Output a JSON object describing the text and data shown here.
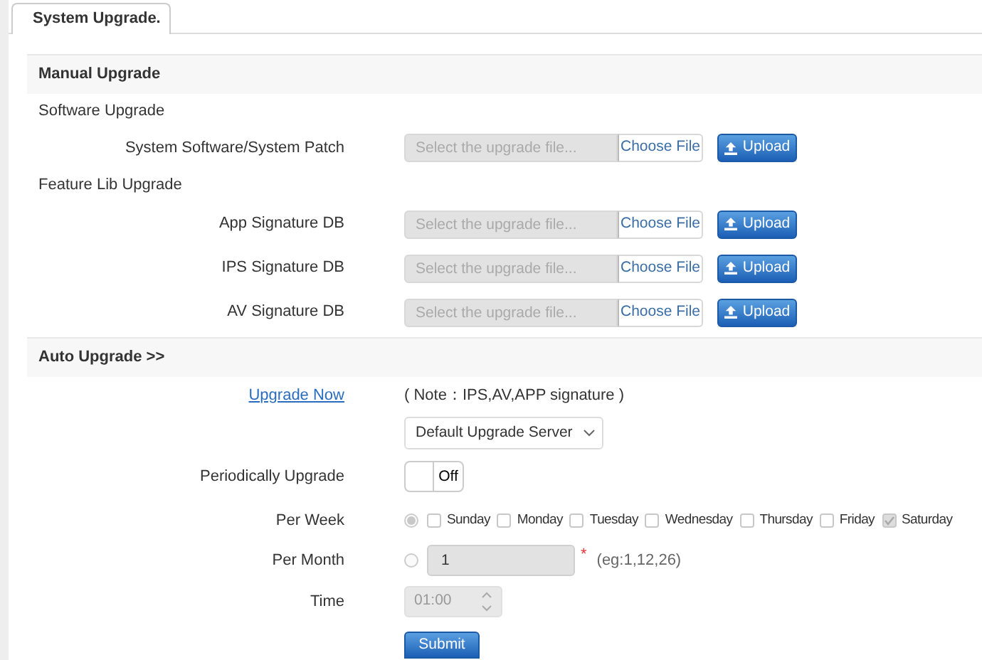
{
  "tab": {
    "label": "System Upgrade.",
    "selected": true
  },
  "manual": {
    "title": "Manual Upgrade",
    "groups": [
      {
        "title": "Software Upgrade",
        "items": [
          {
            "label": "System Software/System Patch",
            "placeholder": "Select the upgrade file...",
            "choose": "Choose File",
            "upload": "Upload"
          }
        ]
      },
      {
        "title": "Feature Lib Upgrade",
        "items": [
          {
            "label": "App Signature DB",
            "placeholder": "Select the upgrade file...",
            "choose": "Choose File",
            "upload": "Upload"
          },
          {
            "label": "IPS Signature DB",
            "placeholder": "Select the upgrade file...",
            "choose": "Choose File",
            "upload": "Upload"
          },
          {
            "label": "AV Signature DB",
            "placeholder": "Select the upgrade file...",
            "choose": "Choose File",
            "upload": "Upload"
          }
        ]
      }
    ]
  },
  "auto": {
    "title": "Auto Upgrade >>",
    "upgrade_now": "Upgrade Now",
    "note": "( Note：IPS,AV,APP signature )",
    "server": "Default Upgrade Server",
    "periodic": {
      "label": "Periodically Upgrade",
      "on": false,
      "state_text": "Off"
    },
    "per_week": {
      "label": "Per Week",
      "selected": true,
      "days": [
        {
          "label": "Sunday",
          "checked": false
        },
        {
          "label": "Monday",
          "checked": false
        },
        {
          "label": "Tuesday",
          "checked": false
        },
        {
          "label": "Wednesday",
          "checked": false
        },
        {
          "label": "Thursday",
          "checked": false
        },
        {
          "label": "Friday",
          "checked": false
        },
        {
          "label": "Saturday",
          "checked": true
        }
      ]
    },
    "per_month": {
      "label": "Per Month",
      "selected": false,
      "value": "1",
      "required_mark": "*",
      "hint": "(eg:1,12,26)"
    },
    "time": {
      "label": "Time",
      "value": "01:00"
    },
    "submit": "Submit"
  }
}
